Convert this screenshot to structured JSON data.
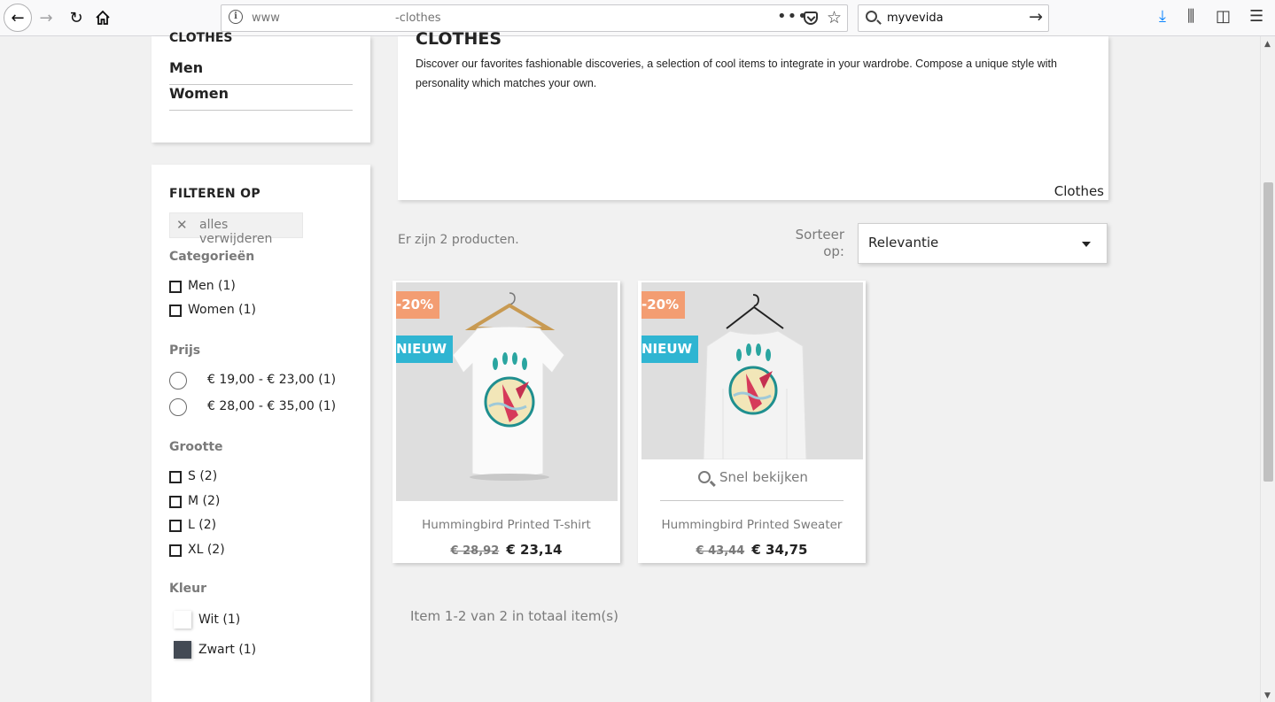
{
  "browser": {
    "url_start": "www",
    "url_end": "-clothes",
    "search_query": "myvevida"
  },
  "sidebar": {
    "categories_heading": "CLOTHES",
    "categories": [
      {
        "label": "Men"
      },
      {
        "label": "Women"
      }
    ],
    "filter": {
      "title": "FILTEREN OP",
      "clear_all": "alles verwijderen",
      "facets": {
        "categories": {
          "title": "Categorieën",
          "items": [
            "Men (1)",
            "Women (1)"
          ]
        },
        "price": {
          "title": "Prijs",
          "items": [
            "€ 19,00 - € 23,00 (1)",
            "€ 28,00 - € 35,00 (1)"
          ]
        },
        "size": {
          "title": "Grootte",
          "items": [
            "S (2)",
            "M (2)",
            "L (2)",
            "XL (2)"
          ]
        },
        "color": {
          "title": "Kleur",
          "items": [
            {
              "label": "Wit (1)",
              "color": "#ffffff"
            },
            {
              "label": "Zwart (1)",
              "color": "#434a54"
            }
          ]
        }
      }
    }
  },
  "header": {
    "title": "CLOTHES",
    "description": "Discover our favorites fashionable discoveries, a selection of cool items to integrate in your wardrobe. Compose a unique style with personality which matches your own.",
    "image_label": "Clothes"
  },
  "listing": {
    "count_text": "Er zijn 2 producten.",
    "sort_label": "Sorteer op:",
    "sort_value": "Relevantie",
    "pagination_text": "Item 1-2 van 2 in totaal item(s)"
  },
  "products": [
    {
      "discount": "-20%",
      "flag": "NIEUW",
      "name": "Hummingbird Printed T-shirt",
      "old_price": "€ 28,92",
      "price": "€ 23,14"
    },
    {
      "discount": "-20%",
      "flag": "NIEUW",
      "name": "Hummingbird Printed Sweater",
      "old_price": "€ 43,44",
      "price": "€ 34,75",
      "quick_view": "Snel bekijken"
    }
  ],
  "colors": {
    "accent_new": "#2fb5d2",
    "accent_discount": "#f39d72",
    "page_bg": "#f1f1f1",
    "text_muted": "#7a7a7a"
  }
}
